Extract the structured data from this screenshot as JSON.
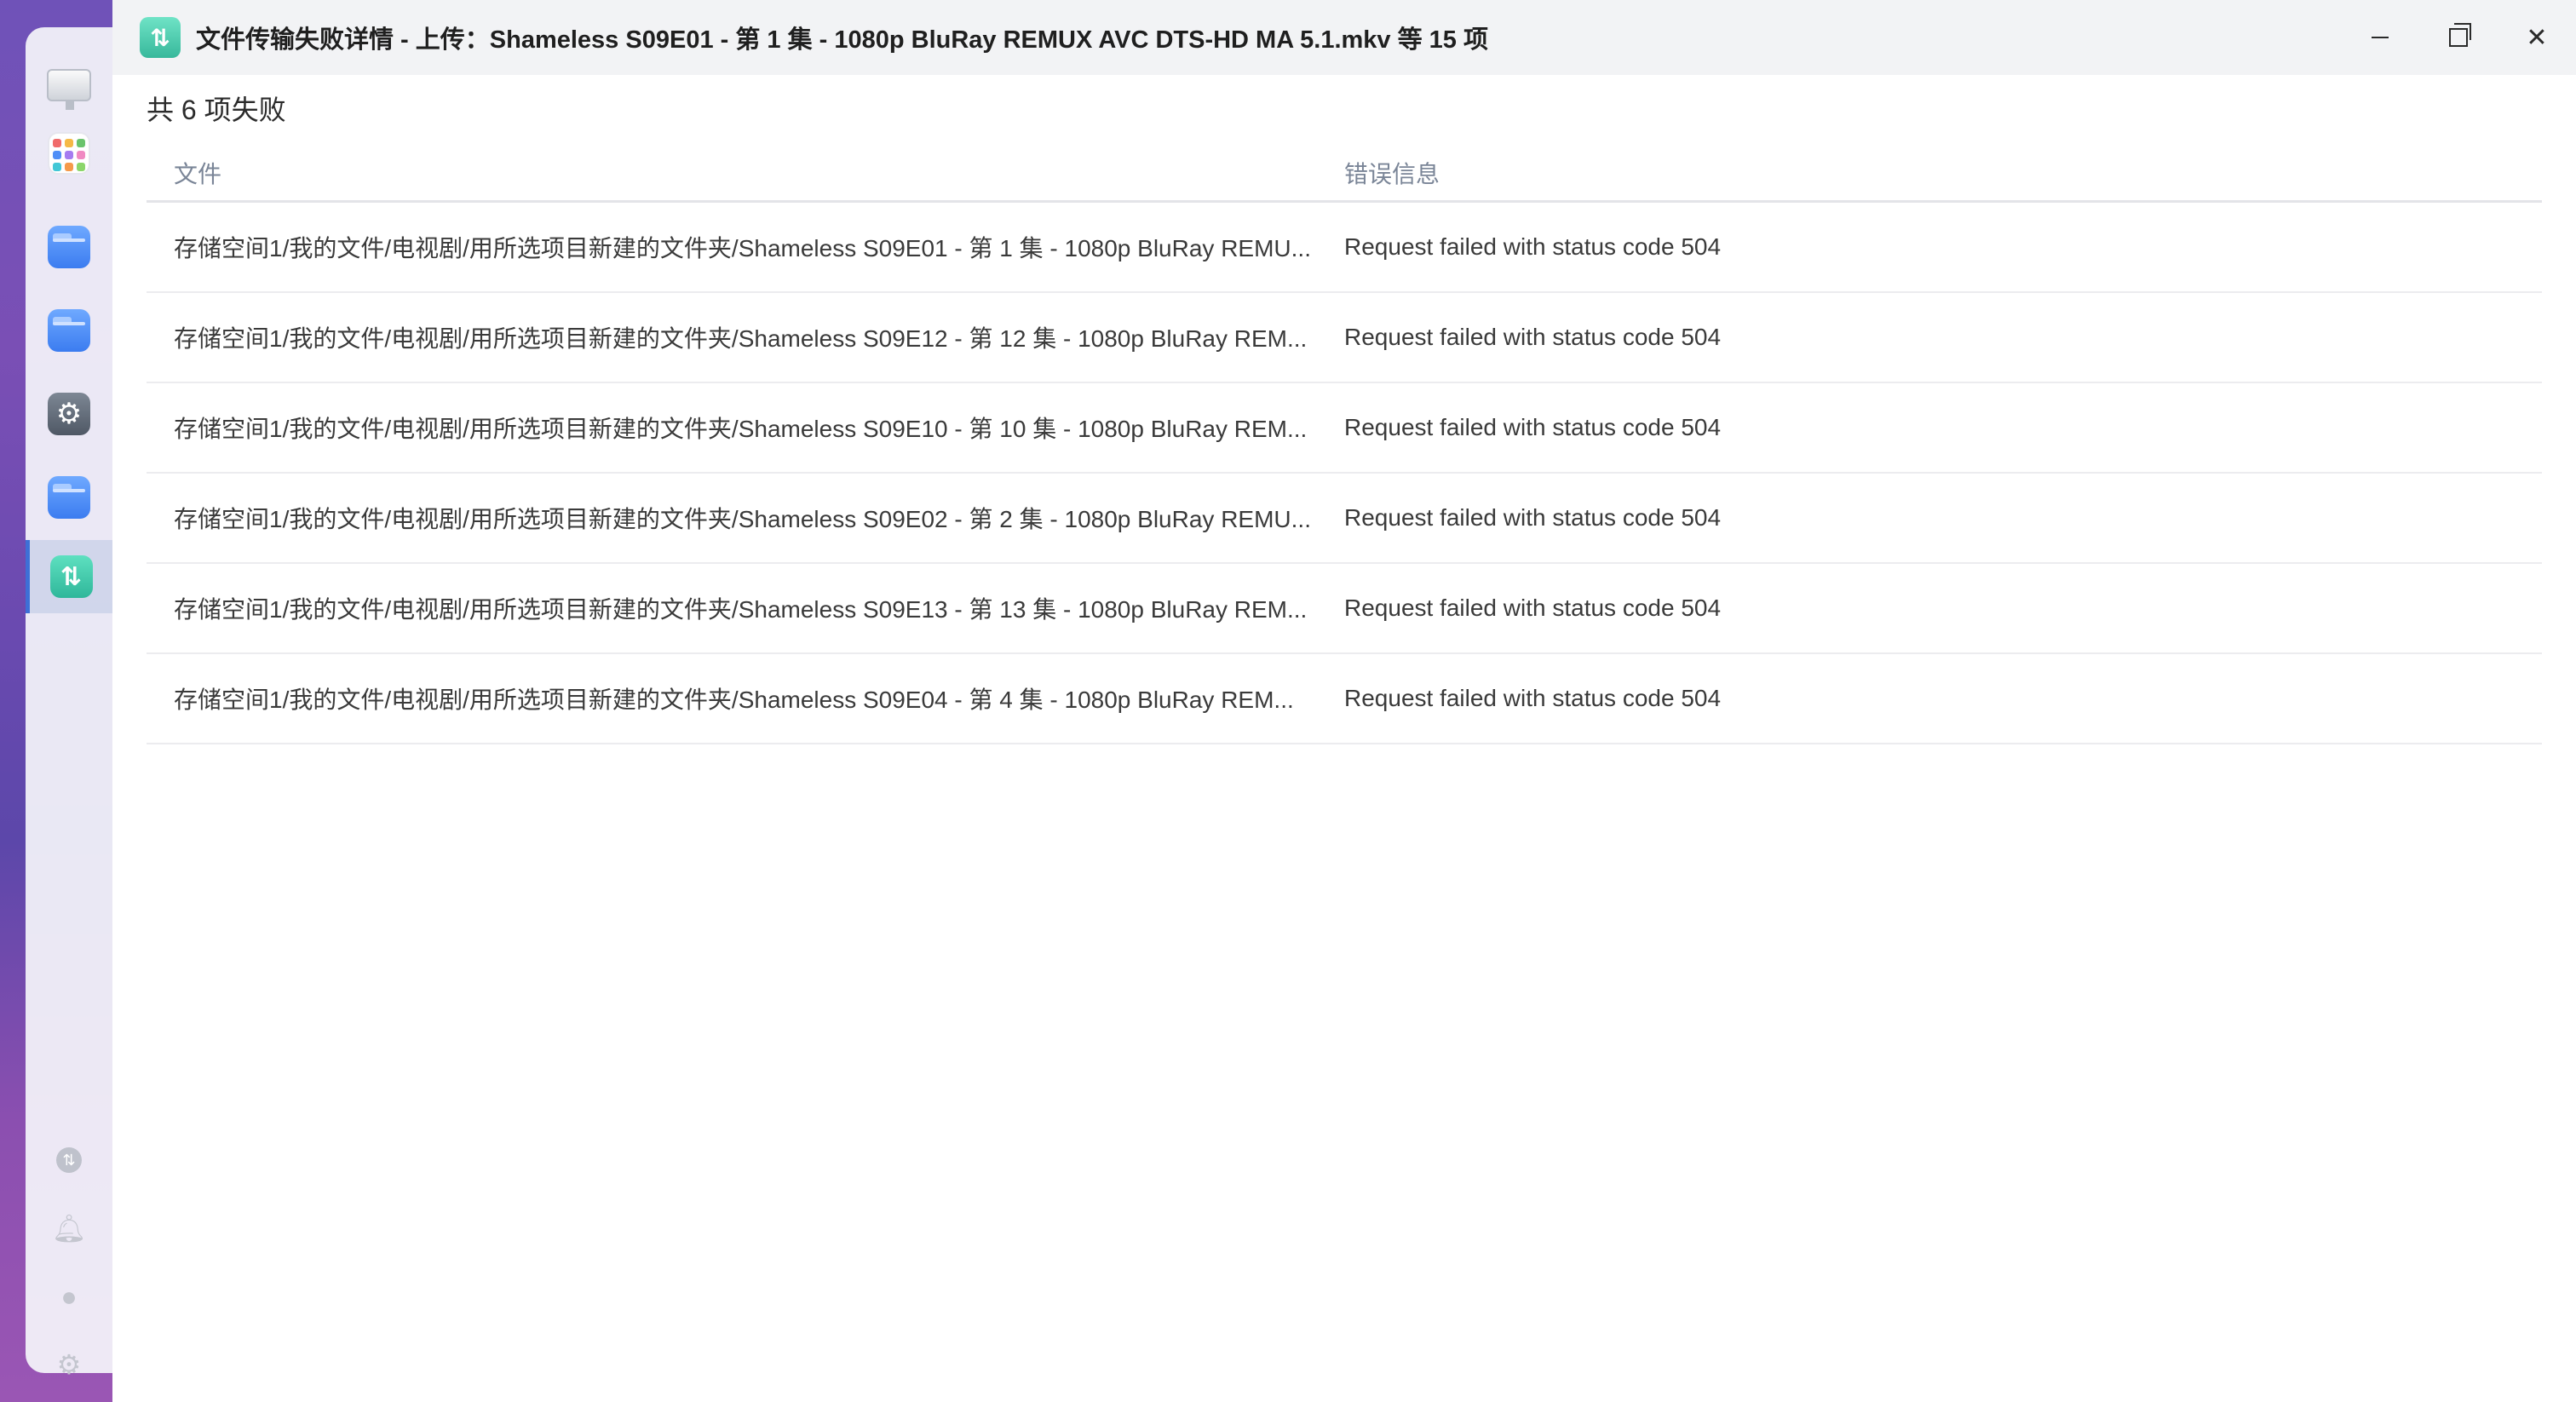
{
  "window": {
    "title": "文件传输失败详情 - 上传：Shameless S09E01 - 第 1 集 - 1080p BluRay REMUX AVC DTS-HD MA 5.1.mkv 等 15 项",
    "icon": "transfer-arrows-icon",
    "controls": {
      "minimize_icon": "minimize-icon",
      "restore_icon": "restore-icon",
      "close_icon": "close-icon",
      "close_glyph": "✕"
    }
  },
  "summary": "共 6 项失败",
  "table": {
    "headers": {
      "file": "文件",
      "error": "错误信息"
    },
    "rows": [
      {
        "file": "存储空间1/我的文件/电视剧/用所选项目新建的文件夹/Shameless S09E01 - 第 1 集 - 1080p BluRay REMU...",
        "error": "Request failed with status code 504"
      },
      {
        "file": "存储空间1/我的文件/电视剧/用所选项目新建的文件夹/Shameless S09E12 - 第 12 集 - 1080p BluRay REM...",
        "error": "Request failed with status code 504"
      },
      {
        "file": "存储空间1/我的文件/电视剧/用所选项目新建的文件夹/Shameless S09E10 - 第 10 集 - 1080p BluRay REM...",
        "error": "Request failed with status code 504"
      },
      {
        "file": "存储空间1/我的文件/电视剧/用所选项目新建的文件夹/Shameless S09E02 - 第 2 集 - 1080p BluRay REMU...",
        "error": "Request failed with status code 504"
      },
      {
        "file": "存储空间1/我的文件/电视剧/用所选项目新建的文件夹/Shameless S09E13 - 第 13 集 - 1080p BluRay REM...",
        "error": "Request failed with status code 504"
      },
      {
        "file": "存储空间1/我的文件/电视剧/用所选项目新建的文件夹/Shameless S09E04 - 第 4 集 - 1080p BluRay REM...",
        "error": "Request failed with status code 504"
      }
    ]
  },
  "dock": {
    "apps": [
      "monitor-icon",
      "app-center-icon",
      "folder-icon",
      "folder-icon",
      "settings-gear-icon",
      "folder-icon",
      "transfer-arrows-icon"
    ],
    "active_app": "transfer-arrows-icon",
    "bottom": [
      "sync-icon",
      "bell-icon",
      "user-icon",
      "gear-icon"
    ]
  },
  "colors": {
    "accent": "#3d6fd6",
    "transfer_icon": "#37b89b",
    "header_text": "#7a8597"
  }
}
